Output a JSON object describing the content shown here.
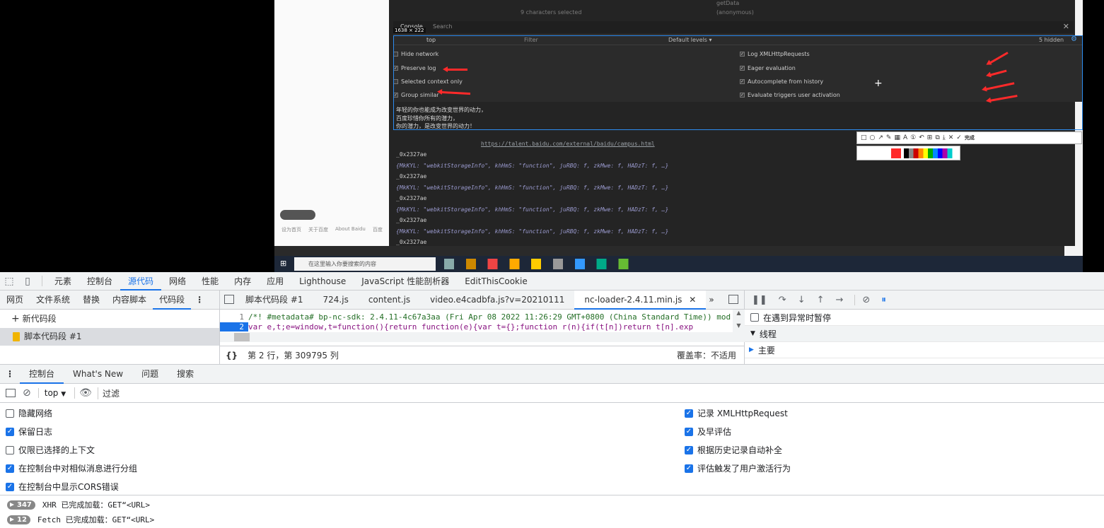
{
  "embedded_screenshot": {
    "size_label": "1638 × 222",
    "panel_tabs": [
      "Console",
      "Search"
    ],
    "context": "top",
    "filter_placeholder": "Filter",
    "levels": "Default levels ▾",
    "hidden": "5 hidden",
    "top_lines": [
      "9 characters selected",
      "(anonymous)",
      "getData"
    ],
    "settings_left": [
      "Hide network",
      "Preserve log",
      "Selected context only",
      "Group similar"
    ],
    "settings_right": [
      "Log XMLHttpRequests",
      "Eager evaluation",
      "Autocomplete from history",
      "Evaluate triggers user activation"
    ],
    "chinese_lines": [
      "年轻的你也能成为改变世界的动力，",
      "百度珍惜你所有的潜力，",
      "你的潜力，是改变世界的动力！"
    ],
    "link": "https://talent.baidu.com/external/baidu/campus.html",
    "log_entries": [
      "_0x2327ae",
      "{MkKYL: \"webkitStorageInfo\", khHmS: \"function\", juRBQ: f, zkMwe: f, HADzT: f, …}"
    ],
    "toolbar_done": "完成",
    "taskbar_search": "在这里输入你要搜索的内容",
    "left_links": [
      "设为首页",
      "关于百度",
      "About Baidu",
      "百度"
    ]
  },
  "main_tabs": [
    "元素",
    "控制台",
    "源代码",
    "网络",
    "性能",
    "内存",
    "应用",
    "Lighthouse",
    "JavaScript 性能剖析器",
    "EditThisCookie"
  ],
  "active_main_tab": "源代码",
  "sources": {
    "nav_tabs": [
      "网页",
      "文件系统",
      "替换",
      "内容脚本",
      "代码段"
    ],
    "new_snippet": "新代码段",
    "snippet_item": "脚本代码段 #1",
    "editor_tabs": [
      "脚本代码段 #1",
      "724.js",
      "content.js",
      "video.e4cadbfa.js?v=20210111",
      "nc-loader-2.4.11.min.js"
    ],
    "code_lines": [
      {
        "n": "1",
        "text": "/*! #metadata# bp-nc-sdk: 2.4.11-4c67a3aa (Fri Apr 08 2022 11:26:29 GMT+0800 (China Standard Time)) mod"
      },
      {
        "n": "2",
        "text": "var e,t;e=window,t=function(){return function(e){var t={};function r(n){if(t[n])return t[n].exp"
      }
    ],
    "status_position": "第 2 行，第 309795 列",
    "coverage": "覆盖率：不适用",
    "braces": "{}"
  },
  "debugger": {
    "pause_on_exceptions": "在遇到异常时暂停",
    "threads_header": "线程",
    "main_thread": "主要"
  },
  "drawer_tabs": [
    "控制台",
    "What's New",
    "问题",
    "搜索"
  ],
  "console": {
    "context": "top",
    "filter_placeholder": "过滤",
    "left_options": [
      {
        "label": "隐藏网络",
        "checked": false
      },
      {
        "label": "保留日志",
        "checked": true
      },
      {
        "label": "仅限已选择的上下文",
        "checked": false
      },
      {
        "label": "在控制台中对相似消息进行分组",
        "checked": true
      },
      {
        "label": "在控制台中显示CORS错误",
        "checked": true
      }
    ],
    "right_options": [
      {
        "label": "记录 XMLHttpRequest",
        "checked": true
      },
      {
        "label": "及早评估",
        "checked": true
      },
      {
        "label": "根据历史记录自动补全",
        "checked": true
      },
      {
        "label": "评估触发了用户激活行为",
        "checked": true
      }
    ],
    "messages": [
      {
        "count": "347",
        "text": "XHR 已完成加载：GET“<URL>"
      },
      {
        "count": "12",
        "text": "Fetch 已完成加载：GET“<URL>"
      }
    ]
  },
  "colors": {
    "accent": "#1a73e8",
    "arrow": "#ff2a2a",
    "selection": "#2d8cf0"
  }
}
